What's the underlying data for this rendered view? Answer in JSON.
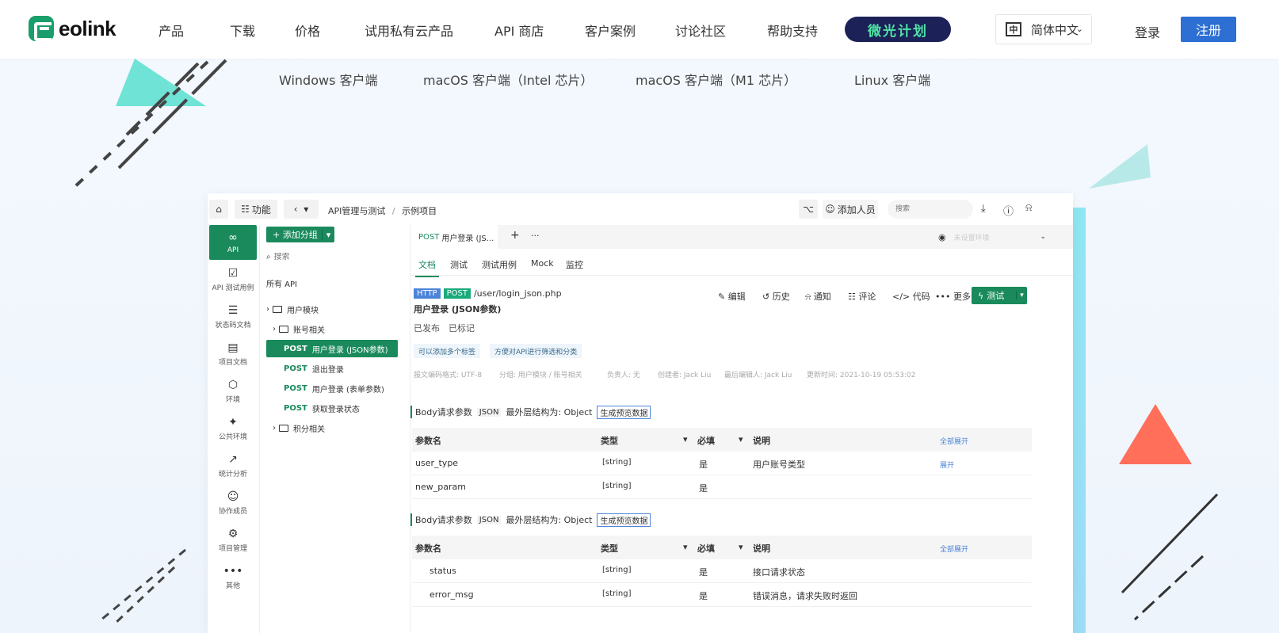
{
  "nav": {
    "brand": "eolink",
    "items": [
      "产品",
      "下载",
      "价格",
      "试用私有云产品",
      "API 商店",
      "客户案例",
      "讨论社区",
      "帮助支持"
    ],
    "plan": "微光计划",
    "lang_icon": "中",
    "lang": "简体中文",
    "login": "登录",
    "signup": "注册",
    "accent": "#2d6fd2",
    "plan_bg": "#1c2158",
    "plan_fg": "#4fe3a6"
  },
  "downloads": [
    "Windows 客户端",
    "macOS 客户端（Intel 芯片）",
    "macOS 客户端（M1 芯片）",
    "Linux 客户端"
  ],
  "app": {
    "toolbar": {
      "functions": "功能",
      "breadcrumb": "API管理与测试",
      "sep": "/",
      "project": "示例项目",
      "add_member": "添加人员",
      "search_placeholder": "搜索"
    },
    "sidebar": [
      {
        "label": "API",
        "icon": "link-icon"
      },
      {
        "label": "API 测试用例",
        "icon": "clipboard-icon"
      },
      {
        "label": "状态码文档",
        "icon": "doc-icon"
      },
      {
        "label": "项目文档",
        "icon": "book-icon"
      },
      {
        "label": "环境",
        "icon": "cube-icon"
      },
      {
        "label": "公共环境",
        "icon": "puzzle-icon"
      },
      {
        "label": "统计分析",
        "icon": "chart-icon"
      },
      {
        "label": "协作成员",
        "icon": "user-icon"
      },
      {
        "label": "项目管理",
        "icon": "settings-icon"
      },
      {
        "label": "其他",
        "icon": "more-icon"
      }
    ],
    "tree": {
      "add_group": "+ 添加分组",
      "search_placeholder": "搜索",
      "all_api": "所有 API",
      "folder_user": "用户模块",
      "folder_account": "账号相关",
      "apis": [
        {
          "method": "POST",
          "name": "用户登录 (JSON参数)"
        },
        {
          "method": "POST",
          "name": "退出登录"
        },
        {
          "method": "POST",
          "name": "用户登录 (表单参数)"
        },
        {
          "method": "POST",
          "name": "获取登录状态"
        }
      ],
      "folder_points": "积分相关"
    },
    "tab": {
      "method": "POST",
      "title": "用户登录 (JS...",
      "plus": "+",
      "more": "···",
      "env_placeholder": "未设置环境"
    },
    "subtabs": [
      "文档",
      "测试",
      "测试用例",
      "Mock",
      "监控"
    ],
    "api": {
      "protocol": "HTTP",
      "method": "POST",
      "path": "/user/login_json.php",
      "name": "用户登录 (JSON参数)",
      "status1": "已发布",
      "status2": "已标记",
      "tags": [
        "可以添加多个标签",
        "方便对API进行筛选和分类"
      ],
      "meta": [
        "报文编码格式: UTF-8",
        "分组: 用户模块 / 账号相关",
        "负责人: 无",
        "创建者: Jack Liu",
        "最后编辑人: Jack Liu",
        "更新时间: 2021-10-19 05:53:02"
      ]
    },
    "actions": [
      "编辑",
      "历史",
      "通知",
      "评论",
      "代码",
      "更多"
    ],
    "test_btn": "测试",
    "req_section": {
      "title": "Body请求参数",
      "fmt": "JSON",
      "struct": "最外层结构为: Object",
      "gen": "生成预览数据"
    },
    "resp_section": {
      "title": "Body请求参数",
      "fmt": "JSON",
      "struct": "最外层结构为: Object",
      "gen": "生成预览数据"
    },
    "table_head": {
      "name": "参数名",
      "type": "类型",
      "required": "必填",
      "desc": "说明",
      "expand_all": "全部展开"
    },
    "req_rows": [
      {
        "name": "user_type",
        "type": "[string]",
        "req": "是",
        "desc": "用户账号类型",
        "link": "展开"
      },
      {
        "name": "new_param",
        "type": "[string]",
        "req": "是",
        "desc": "",
        "link": ""
      }
    ],
    "resp_rows": [
      {
        "name": "status",
        "type": "[string]",
        "req": "是",
        "desc": "接口请求状态"
      },
      {
        "name": "error_msg",
        "type": "[string]",
        "req": "是",
        "desc": "错误消息，请求失败时返回"
      }
    ]
  }
}
